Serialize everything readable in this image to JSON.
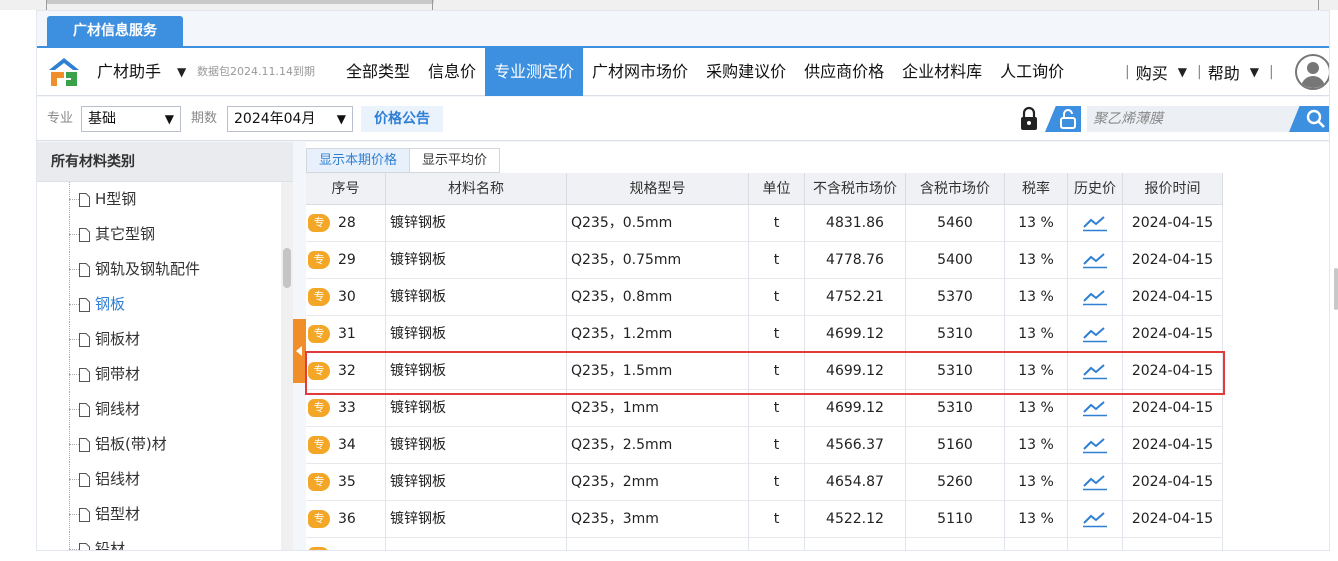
{
  "app_tab": "广材信息服务",
  "menubar": {
    "brand": "广材助手",
    "data_package": "数据包2024.11.14到期",
    "nav": [
      "全部类型",
      "信息价",
      "专业测定价",
      "广材网市场价",
      "采购建议价",
      "供应商价格",
      "企业材料库",
      "人工询价"
    ],
    "active_nav": "专业测定价",
    "buy": "购买",
    "help": "帮助",
    "caret": "▼",
    "separator": "|"
  },
  "filters": {
    "major_label": "专业",
    "major_value": "基础",
    "period_label": "期数",
    "period_value": "2024年04月",
    "notice_button": "价格公告",
    "search_placeholder": "聚乙烯薄膜",
    "caret": "▼"
  },
  "sidebar": {
    "title": "所有材料类别",
    "items": [
      "H型钢",
      "其它型钢",
      "钢轨及钢轨配件",
      "钢板",
      "铜板材",
      "铜带材",
      "铜线材",
      "铝板(带)材",
      "铝线材",
      "铝型材",
      "铅材"
    ],
    "selected": "钢板"
  },
  "subtabs": [
    "显示本期价格",
    "显示平均价"
  ],
  "active_subtab": "显示本期价格",
  "table": {
    "columns": [
      "序号",
      "材料名称",
      "规格型号",
      "单位",
      "不含税市场价",
      "含税市场价",
      "税率",
      "历史价",
      "报价时间"
    ],
    "badge": "专",
    "rows": [
      {
        "seq": "28",
        "name": "镀锌钢板",
        "spec": "Q235，0.5mm",
        "unit": "t",
        "price_ex": "4831.86",
        "price_in": "5460",
        "tax": "13 %",
        "date": "2024-04-15"
      },
      {
        "seq": "29",
        "name": "镀锌钢板",
        "spec": "Q235，0.75mm",
        "unit": "t",
        "price_ex": "4778.76",
        "price_in": "5400",
        "tax": "13 %",
        "date": "2024-04-15"
      },
      {
        "seq": "30",
        "name": "镀锌钢板",
        "spec": "Q235，0.8mm",
        "unit": "t",
        "price_ex": "4752.21",
        "price_in": "5370",
        "tax": "13 %",
        "date": "2024-04-15"
      },
      {
        "seq": "31",
        "name": "镀锌钢板",
        "spec": "Q235，1.2mm",
        "unit": "t",
        "price_ex": "4699.12",
        "price_in": "5310",
        "tax": "13 %",
        "date": "2024-04-15"
      },
      {
        "seq": "32",
        "name": "镀锌钢板",
        "spec": "Q235，1.5mm",
        "unit": "t",
        "price_ex": "4699.12",
        "price_in": "5310",
        "tax": "13 %",
        "date": "2024-04-15"
      },
      {
        "seq": "33",
        "name": "镀锌钢板",
        "spec": "Q235，1mm",
        "unit": "t",
        "price_ex": "4699.12",
        "price_in": "5310",
        "tax": "13 %",
        "date": "2024-04-15"
      },
      {
        "seq": "34",
        "name": "镀锌钢板",
        "spec": "Q235，2.5mm",
        "unit": "t",
        "price_ex": "4566.37",
        "price_in": "5160",
        "tax": "13 %",
        "date": "2024-04-15"
      },
      {
        "seq": "35",
        "name": "镀锌钢板",
        "spec": "Q235，2mm",
        "unit": "t",
        "price_ex": "4654.87",
        "price_in": "5260",
        "tax": "13 %",
        "date": "2024-04-15"
      },
      {
        "seq": "36",
        "name": "镀锌钢板",
        "spec": "Q235，3mm",
        "unit": "t",
        "price_ex": "4522.12",
        "price_in": "5110",
        "tax": "13 %",
        "date": "2024-04-15"
      }
    ],
    "highlighted_seq": "32"
  },
  "colors": {
    "accent": "#3d8fe0",
    "badge": "#f4a627",
    "highlight": "#e23b3b",
    "collapse_tab": "#f08e2c"
  }
}
